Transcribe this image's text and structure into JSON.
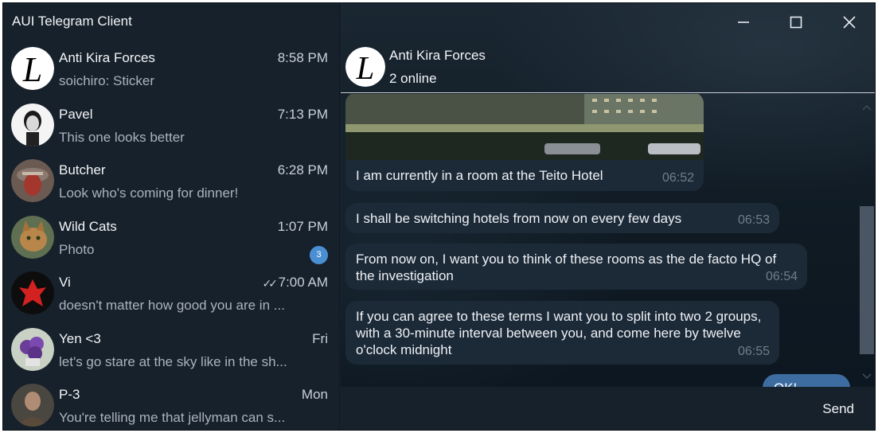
{
  "app": {
    "title": "AUI Telegram Client"
  },
  "chats": [
    {
      "name": "Anti Kira Forces",
      "time": "8:58 PM",
      "preview": "soichiro: Sticker"
    },
    {
      "name": "Pavel",
      "time": "7:13 PM",
      "preview": "This one looks better"
    },
    {
      "name": "Butcher",
      "time": "6:28 PM",
      "preview": "Look who's coming for dinner!"
    },
    {
      "name": "Wild Cats",
      "time": "1:07 PM",
      "preview": "Photo",
      "unread": "3"
    },
    {
      "name": "Vi",
      "time": "7:00 AM",
      "preview": "doesn't matter how good you are in ...",
      "read_ticks": "✓✓"
    },
    {
      "name": "Yen <3",
      "time": "Fri",
      "preview": "let's go stare at the sky like in the sh..."
    },
    {
      "name": "P-3",
      "time": "Mon",
      "preview": "You're telling me that jellyman can s..."
    }
  ],
  "header": {
    "title": "Anti Kira Forces",
    "status": "2 online"
  },
  "messages": [
    {
      "text": "I am currently in a room at the Teito Hotel",
      "time": "06:52"
    },
    {
      "text": "I shall be switching hotels from now on every few days",
      "time": "06:53"
    },
    {
      "text": "From now on, I want you to think of these rooms as the de facto HQ of the investigation",
      "time": "06:54"
    },
    {
      "text": "If you can agree to these terms I want you to split into two 2 groups, with a 30-minute interval between you, and come here by twelve o'clock midnight",
      "time": "06:55"
    }
  ],
  "outgoing": {
    "text": "OK!"
  },
  "composer": {
    "placeholder": "",
    "send_label": "Send"
  },
  "colors": {
    "accent": "#4b8fd3",
    "outgoing_bubble": "#3d6da0",
    "incoming_bubble": "#1c2a38",
    "sidebar_bg": "#17212b"
  }
}
